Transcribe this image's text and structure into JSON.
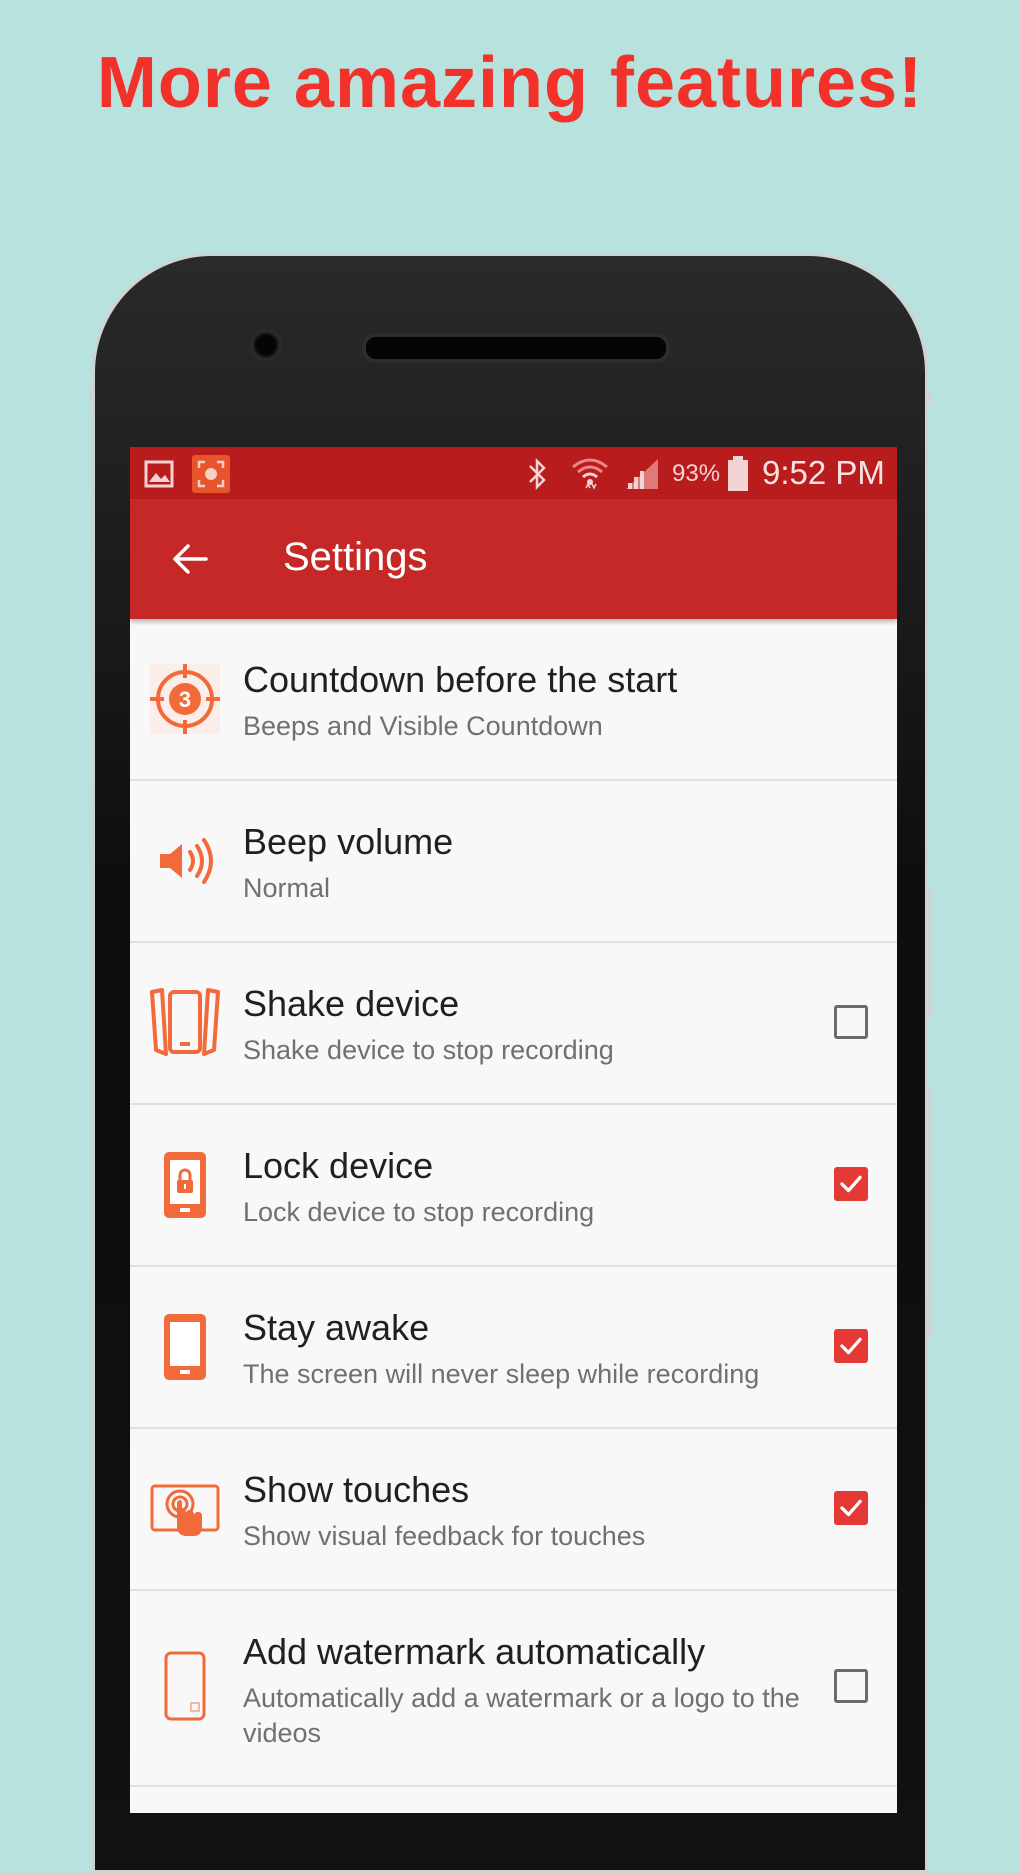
{
  "promo": {
    "headline": "More amazing features!"
  },
  "status_bar": {
    "battery_percent": "93%",
    "time": "9:52 PM",
    "icons": [
      "image-notification-icon",
      "screen-recorder-notification-icon",
      "bluetooth-icon",
      "wifi-icon",
      "cell-signal-icon",
      "battery-icon"
    ]
  },
  "app_bar": {
    "title": "Settings",
    "back_icon": "arrow-back-icon"
  },
  "settings": [
    {
      "title": "Countdown before the start",
      "subtitle": "Beeps and Visible Countdown",
      "icon": "countdown-icon",
      "checkbox": null
    },
    {
      "title": "Beep volume",
      "subtitle": "Normal",
      "icon": "volume-icon",
      "checkbox": null
    },
    {
      "title": "Shake device",
      "subtitle": "Shake device to stop recording",
      "icon": "shake-device-icon",
      "checkbox": false
    },
    {
      "title": "Lock device",
      "subtitle": "Lock device to stop recording",
      "icon": "lock-device-icon",
      "checkbox": true
    },
    {
      "title": "Stay awake",
      "subtitle": "The screen will never sleep while recording",
      "icon": "phone-icon",
      "checkbox": true
    },
    {
      "title": "Show touches",
      "subtitle": "Show visual feedback for touches",
      "icon": "touch-icon",
      "checkbox": true
    },
    {
      "title": "Add watermark automatically",
      "subtitle": "Automatically add a watermark or a logo to the videos",
      "icon": "watermark-icon",
      "checkbox": false
    }
  ],
  "colors": {
    "accent": "#e53935",
    "app_bar": "#c62828",
    "status_bar": "#b81c1c",
    "icon_orange": "#f26a3a",
    "background": "#b8e2de"
  }
}
